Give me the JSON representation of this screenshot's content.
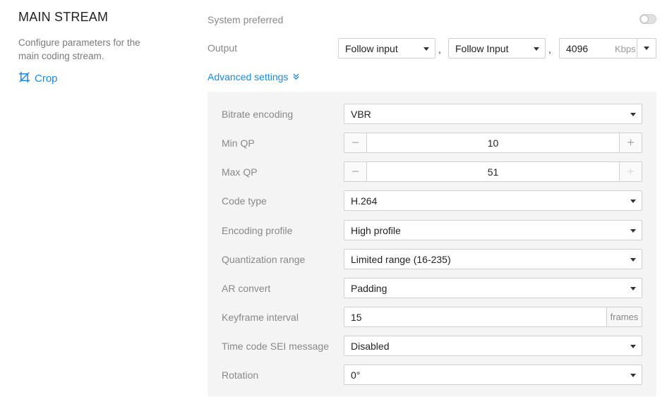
{
  "section": {
    "title": "MAIN STREAM",
    "description": "Configure parameters for the main coding stream.",
    "crop_label": "Crop"
  },
  "system_preferred": {
    "label": "System preferred",
    "enabled": false
  },
  "output": {
    "label": "Output",
    "select1": "Follow input",
    "select2": "Follow Input",
    "separator": ",",
    "bitrate_value": "4096",
    "bitrate_unit": "Kbps"
  },
  "advanced": {
    "label": "Advanced settings",
    "bitrate_encoding": {
      "label": "Bitrate encoding",
      "value": "VBR"
    },
    "min_qp": {
      "label": "Min QP",
      "value": "10",
      "minus": "−",
      "plus": "+"
    },
    "max_qp": {
      "label": "Max QP",
      "value": "51",
      "minus": "−",
      "plus": "+"
    },
    "code_type": {
      "label": "Code type",
      "value": "H.264"
    },
    "encoding_profile": {
      "label": "Encoding profile",
      "value": "High profile"
    },
    "quantization_range": {
      "label": "Quantization range",
      "value": "Limited range (16-235)"
    },
    "ar_convert": {
      "label": "AR convert",
      "value": "Padding"
    },
    "keyframe_interval": {
      "label": "Keyframe interval",
      "value": "15",
      "unit": "frames"
    },
    "time_code_sei": {
      "label": "Time code SEI message",
      "value": "Disabled"
    },
    "rotation": {
      "label": "Rotation",
      "value": "0°"
    }
  },
  "colors": {
    "accent": "#1e88e5",
    "panel_bg": "#f4f4f4",
    "label_gray": "#888888"
  }
}
